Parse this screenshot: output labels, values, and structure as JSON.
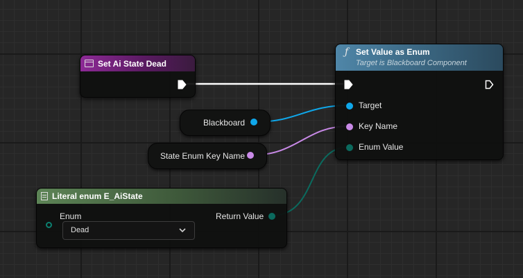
{
  "nodes": {
    "set_ai_state": {
      "title": "Set Ai State Dead",
      "header_color": "#7a1e82"
    },
    "set_value_enum": {
      "title": "Set Value as Enum",
      "subtitle": "Target is Blackboard Component",
      "header_color": "#3d6a86",
      "pins": {
        "target": "Target",
        "key_name": "Key Name",
        "enum_value": "Enum Value"
      }
    },
    "blackboard": {
      "label": "Blackboard"
    },
    "state_key": {
      "label": "State Enum Key Name"
    },
    "literal_enum": {
      "title": "Literal enum E_AiState",
      "header_color": "#4f6f49",
      "enum_label": "Enum",
      "selected": "Dead",
      "return_label": "Return Value"
    }
  },
  "colors": {
    "object_pin": "#0fa7ea",
    "name_pin": "#c98ae8",
    "enum_pin": "#0b6a5e",
    "exec_pin": "#ffffff"
  },
  "icons": {
    "function": "function-icon",
    "event": "custom-event-icon",
    "literal": "literal-icon",
    "dropdown": "chevron-down-icon"
  }
}
